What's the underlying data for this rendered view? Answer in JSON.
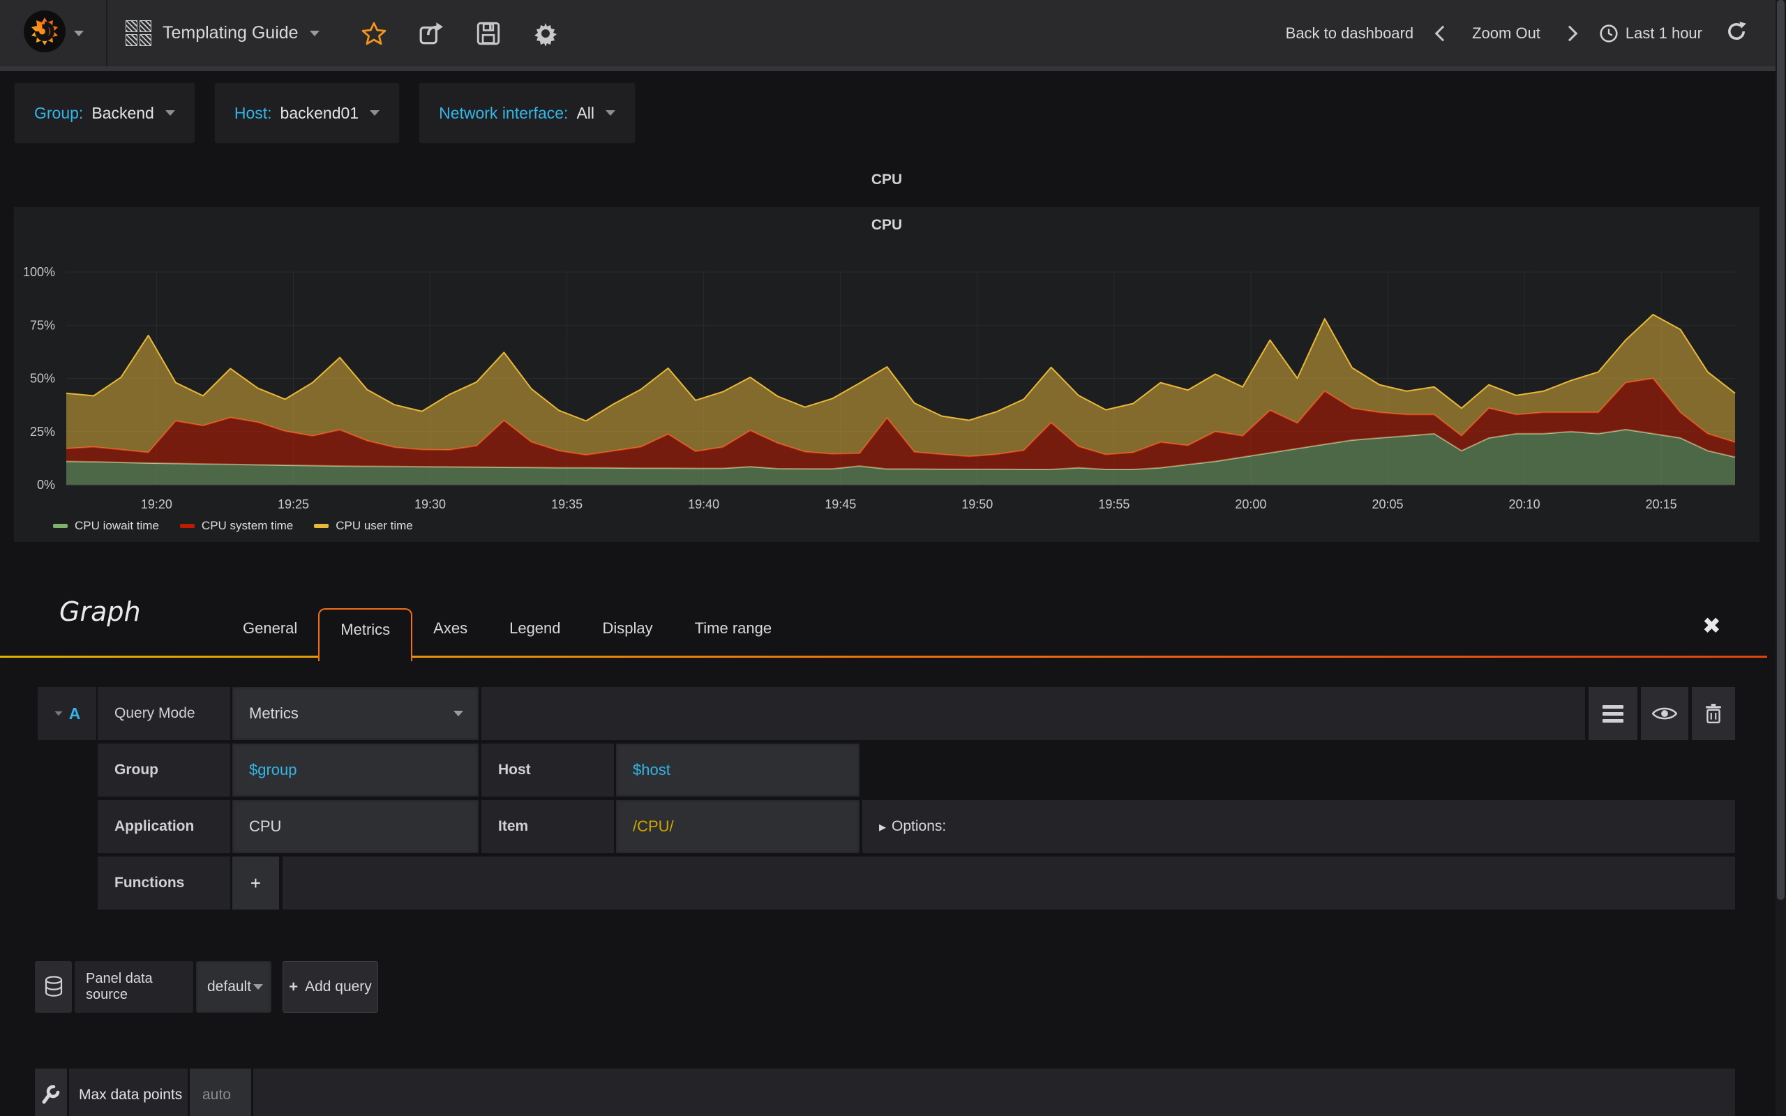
{
  "navbar": {
    "dashboard_title": "Templating Guide",
    "back_label": "Back to dashboard",
    "zoom_out_label": "Zoom Out",
    "time_label": "Last 1 hour"
  },
  "icons": {
    "caret_down": "▾",
    "options_caret": "▸",
    "close": "✖",
    "plus": "+"
  },
  "variables": [
    {
      "label": "Group:",
      "value": "Backend"
    },
    {
      "label": "Host:",
      "value": "backend01"
    },
    {
      "label": "Network interface:",
      "value": "All"
    }
  ],
  "panel": {
    "row_title": "CPU",
    "title": "CPU"
  },
  "chart_data": {
    "type": "area",
    "stacked": true,
    "title": "CPU",
    "ylabel": "percent",
    "y_range": [
      0,
      100
    ],
    "x_range": [
      0,
      61
    ],
    "grid": true,
    "legend_position": "bottom-left",
    "y_ticks": [
      {
        "v": 0,
        "label": "0%"
      },
      {
        "v": 25,
        "label": "25%"
      },
      {
        "v": 50,
        "label": "50%"
      },
      {
        "v": 75,
        "label": "75%"
      },
      {
        "v": 100,
        "label": "100%"
      }
    ],
    "x_ticks": [
      {
        "m": 3.3,
        "label": "19:20"
      },
      {
        "m": 8.3,
        "label": "19:25"
      },
      {
        "m": 13.3,
        "label": "19:30"
      },
      {
        "m": 18.3,
        "label": "19:35"
      },
      {
        "m": 23.3,
        "label": "19:40"
      },
      {
        "m": 28.3,
        "label": "19:45"
      },
      {
        "m": 33.3,
        "label": "19:50"
      },
      {
        "m": 38.3,
        "label": "19:55"
      },
      {
        "m": 43.3,
        "label": "20:00"
      },
      {
        "m": 48.3,
        "label": "20:05"
      },
      {
        "m": 53.3,
        "label": "20:10"
      },
      {
        "m": 58.3,
        "label": "20:15"
      }
    ],
    "series": [
      {
        "name": "CPU iowait time",
        "color": "#7EB26D",
        "line": "#a9c697",
        "fill": "rgba(126,178,109,0.5)",
        "values": [
          11,
          10.8,
          10.5,
          10.2,
          10,
          9.8,
          9.6,
          9.4,
          9.2,
          9,
          8.8,
          8.7,
          8.6,
          8.5,
          8.4,
          8.3,
          8.2,
          8.1,
          8,
          8,
          7.9,
          7.8,
          7.8,
          7.7,
          7.7,
          8.5,
          7.6,
          7.5,
          7.5,
          8.8,
          7.4,
          7.4,
          7.3,
          7.3,
          7.3,
          7.2,
          7.2,
          8,
          7.2,
          7.2,
          8,
          9.5,
          11,
          13,
          15,
          17,
          19,
          21,
          22,
          23,
          24,
          16,
          22,
          24,
          24,
          25,
          24,
          26,
          24,
          22,
          16,
          13
        ]
      },
      {
        "name": "CPU system time",
        "color": "#BF1B00",
        "line": "#d2301b",
        "fill": "rgba(191,27,0,0.55)",
        "values": [
          6,
          7,
          6,
          5,
          20,
          18,
          22,
          20,
          16,
          14,
          17,
          12,
          9,
          8,
          8,
          10,
          22,
          12,
          8,
          6,
          8,
          10,
          16,
          8,
          10,
          17,
          12,
          8,
          7,
          6,
          24,
          8,
          7,
          6,
          7,
          9,
          22,
          10,
          7,
          8,
          12,
          9,
          14,
          10,
          20,
          12,
          25,
          15,
          12,
          10,
          9,
          7,
          14,
          9,
          10,
          9,
          10,
          22,
          26,
          12,
          8,
          7
        ]
      },
      {
        "name": "CPU user time",
        "color": "#EAB839",
        "line": "#eab839",
        "fill": "rgba(234,184,57,0.5)",
        "values": [
          26,
          24,
          34,
          55,
          18,
          14,
          23,
          16,
          15,
          25,
          34,
          24,
          20,
          18,
          26,
          30,
          32,
          25,
          19,
          16,
          22,
          27,
          31,
          24,
          26,
          25,
          22,
          21,
          26,
          33,
          24,
          23,
          18,
          17,
          20,
          24,
          26,
          24,
          21,
          23,
          28,
          26,
          27,
          23,
          33,
          21,
          34,
          19,
          13,
          11,
          13,
          13,
          11,
          9,
          10,
          15,
          19,
          20,
          30,
          39,
          29,
          23
        ]
      }
    ]
  },
  "editor": {
    "panel_type": "Graph",
    "tabs": [
      {
        "label": "General"
      },
      {
        "label": "Metrics"
      },
      {
        "label": "Axes"
      },
      {
        "label": "Legend"
      },
      {
        "label": "Display"
      },
      {
        "label": "Time range"
      }
    ],
    "query": {
      "ref": "A",
      "mode_label": "Query Mode",
      "mode_value": "Metrics",
      "group_label": "Group",
      "group_value": "$group",
      "host_label": "Host",
      "host_value": "$host",
      "application_label": "Application",
      "application_value": "CPU",
      "item_label": "Item",
      "item_value": "/CPU/",
      "options_label": "Options:",
      "functions_label": "Functions"
    },
    "datasource": {
      "label": "Panel data source",
      "value": "default",
      "add_query_label": "Add query"
    },
    "options_row": {
      "label": "Max data points",
      "placeholder": "auto"
    }
  }
}
